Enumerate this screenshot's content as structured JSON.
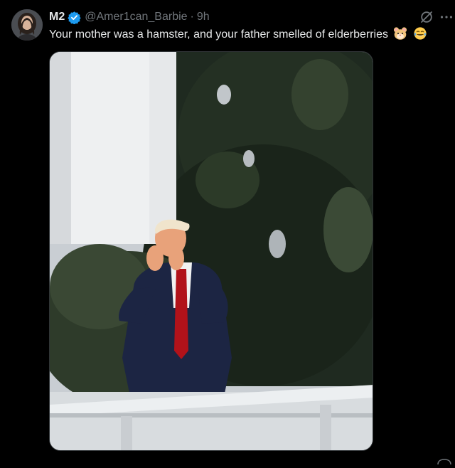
{
  "tweet": {
    "display_name": "M2",
    "handle": "@Amer1can_Barbie",
    "separator": "·",
    "time": "9h",
    "text": "Your mother was a hamster, and your father smelled of elderberries",
    "emojis": [
      "hamster-face-emoji",
      "tears-of-joy-emoji"
    ],
    "verified": true,
    "media_alt": "Photo: man in dark suit and red tie shouting with hands cupped around mouth on a white balcony in front of trees and a white column"
  },
  "icons": {
    "verified": "verified-badge-icon",
    "grok": "grok-icon",
    "more": "more-icon"
  },
  "colors": {
    "background": "#000000",
    "text": "#e7e9ea",
    "secondary": "#71767b",
    "verified_blue": "#1d9bf0"
  }
}
